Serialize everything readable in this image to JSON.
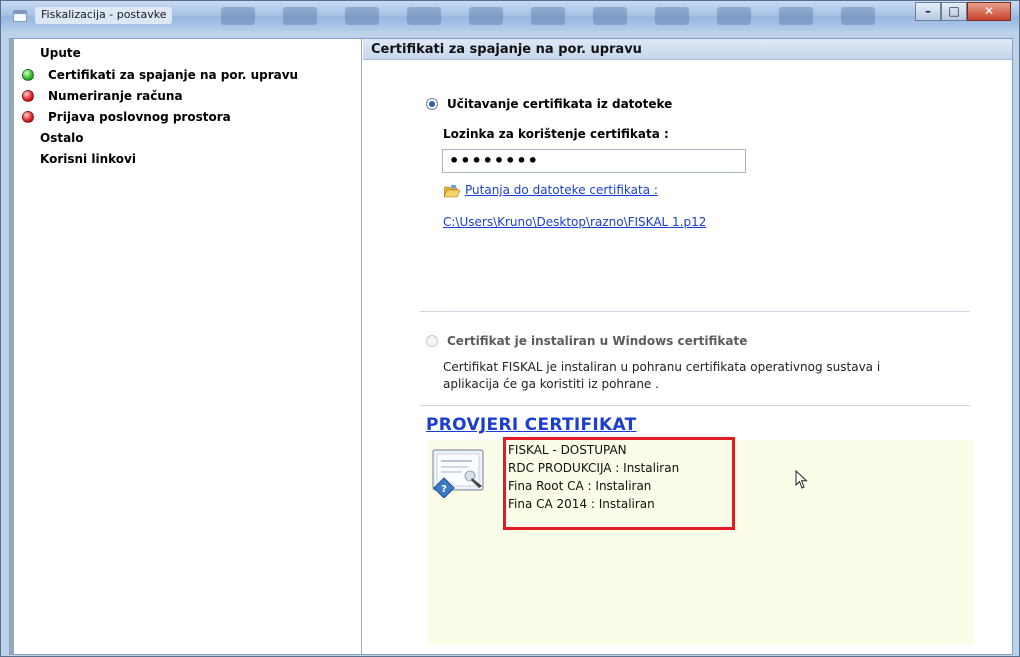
{
  "window": {
    "title": "Fiskalizacija - postavke"
  },
  "sidebar": {
    "items": [
      {
        "label": "Upute",
        "status": "none"
      },
      {
        "label": "Certifikati za spajanje na por. upravu",
        "status": "green"
      },
      {
        "label": "Numeriranje računa",
        "status": "red"
      },
      {
        "label": "Prijava poslovnog prostora",
        "status": "red"
      },
      {
        "label": "Ostalo",
        "status": "none"
      },
      {
        "label": "Korisni linkovi",
        "status": "none"
      }
    ]
  },
  "main": {
    "section_title": "Certifikati za spajanje na por. upravu",
    "option_file": {
      "label": "Učitavanje certifikata iz datoteke",
      "selected": true,
      "password_label": "Lozinka za korištenje certifikata :",
      "password_value": "••••••••",
      "path_link_label": "Putanja do datoteke certifikata :",
      "path_value": "C:\\Users\\Kruno\\Desktop\\razno\\FISKAL 1.p12"
    },
    "option_windows": {
      "label": "Certifikat je instaliran u Windows certifikate",
      "selected": false,
      "description": "Certifikat FISKAL je instaliran u pohranu certifikata operativnog sustava i aplikacija će ga koristiti iz pohrane ."
    },
    "check_title": "PROVJERI CERTIFIKAT",
    "results": [
      "FISKAL - DOSTUPAN",
      "RDC PRODUKCIJA : Instaliran",
      "Fina Root CA : Instaliran",
      "Fina CA 2014 : Instaliran"
    ]
  },
  "colors": {
    "link": "#1a3fd0",
    "highlight_border": "#e21c26",
    "result_panel": "#fcfde8",
    "status_green": "#34c02c",
    "status_red": "#e3262a"
  },
  "icons": {
    "folder": "folder-open-icon",
    "certificate": "certificate-icon",
    "cursor": "mouse-pointer-icon"
  }
}
